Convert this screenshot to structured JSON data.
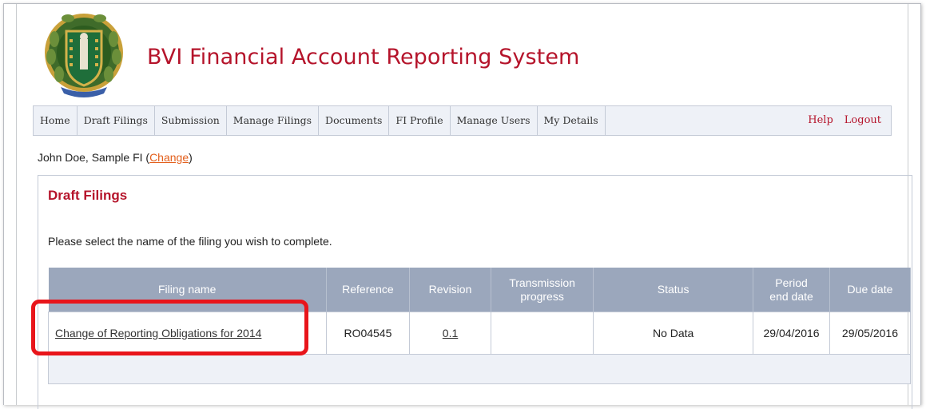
{
  "header": {
    "site_title": "BVI Financial Account Reporting System",
    "logo_icon": "bvi-coat-of-arms-icon"
  },
  "nav": {
    "items": [
      "Home",
      "Draft Filings",
      "Submission",
      "Manage Filings",
      "Documents",
      "FI Profile",
      "Manage Users",
      "My Details"
    ],
    "help": "Help",
    "logout": "Logout"
  },
  "user": {
    "prefix": "John Doe, Sample FI (",
    "change_link": "Change",
    "suffix": ")"
  },
  "panel": {
    "title": "Draft Filings",
    "description": "Please select the name of the filing you wish to complete."
  },
  "table": {
    "headers": {
      "filing_name": "Filing name",
      "reference": "Reference",
      "revision": "Revision",
      "transmission_line1": "Transmission",
      "transmission_line2": "progress",
      "status": "Status",
      "period_line1": "Period",
      "period_line2": "end date",
      "due_date": "Due date"
    },
    "rows": [
      {
        "filing_name": "Change of Reporting Obligations for 2014",
        "reference": "RO04545",
        "revision": "0.1",
        "transmission": "",
        "status": "No Data",
        "period_end_date": "29/04/2016",
        "due_date": "29/05/2016"
      }
    ]
  },
  "colors": {
    "brand_red": "#b5142b",
    "header_blue": "#9ba7bc",
    "link_orange": "#e35f1c",
    "highlight_red": "#e8151b"
  }
}
